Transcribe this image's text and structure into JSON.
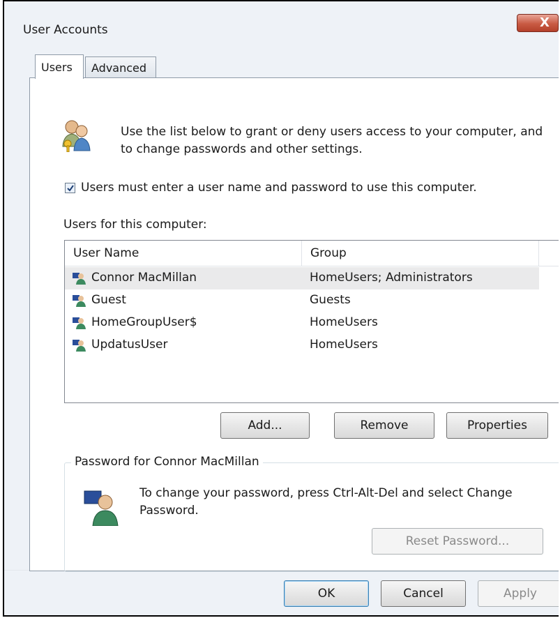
{
  "window": {
    "title": "User Accounts",
    "close_glyph": "X"
  },
  "tabs": [
    {
      "label": "Users",
      "active": true
    },
    {
      "label": "Advanced",
      "active": false
    }
  ],
  "intro": {
    "icon": "users-key-icon",
    "text": "Use the list below to grant or deny users access to your computer, and to change passwords and other settings."
  },
  "require_login": {
    "checked": true,
    "label": "Users must enter a user name and password to use this computer."
  },
  "users_list": {
    "label": "Users for this computer:",
    "columns": [
      "User Name",
      "Group"
    ],
    "rows": [
      {
        "name": "Connor MacMillan",
        "group": "HomeUsers; Administrators",
        "selected": true
      },
      {
        "name": "Guest",
        "group": "Guests",
        "selected": false
      },
      {
        "name": "HomeGroupUser$",
        "group": "HomeUsers",
        "selected": false
      },
      {
        "name": "UpdatusUser",
        "group": "HomeUsers",
        "selected": false
      }
    ]
  },
  "list_buttons": {
    "add": "Add...",
    "remove": "Remove",
    "properties": "Properties"
  },
  "password_group": {
    "legend": "Password for Connor MacMillan",
    "icon": "user-icon",
    "text": "To change your password, press Ctrl-Alt-Del and select Change Password.",
    "reset_button": "Reset Password..."
  },
  "dialog_buttons": {
    "ok": "OK",
    "cancel": "Cancel",
    "apply": "Apply"
  }
}
